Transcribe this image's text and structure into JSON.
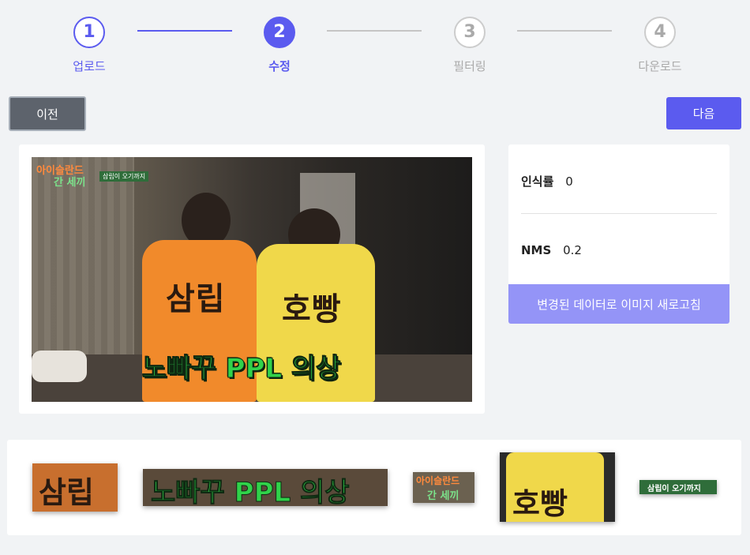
{
  "stepper": {
    "steps": [
      {
        "number": "1",
        "label": "업로드",
        "state": "done"
      },
      {
        "number": "2",
        "label": "수정",
        "state": "active"
      },
      {
        "number": "3",
        "label": "필터링",
        "state": "pending"
      },
      {
        "number": "4",
        "label": "다운로드",
        "state": "pending"
      }
    ],
    "active_color": "#5b5bef",
    "inactive_color": "#aaaaaa"
  },
  "buttons": {
    "prev_label": "이전",
    "next_label": "다음"
  },
  "image": {
    "logo_line1_a": "아이슬란드",
    "logo_line2": "간 세끼",
    "tag": "삼립이 오기까지",
    "shirt_left": "삼립",
    "shirt_right": "호빵",
    "caption": "노빠꾸 PPL 의상"
  },
  "settings": {
    "recognition_label": "인식률",
    "recognition_value": "0",
    "nms_label": "NMS",
    "nms_value": "0.2",
    "refresh_label": "변경된 데이터로 이미지 새로고침"
  },
  "crops": [
    {
      "text": "삼립"
    },
    {
      "text": "노빠꾸 PPL 의상"
    },
    {
      "text_a": "아이슬란드",
      "text_b": "간 세끼"
    },
    {
      "text": "호빵"
    },
    {
      "text": "삼립이 오기까지"
    }
  ]
}
